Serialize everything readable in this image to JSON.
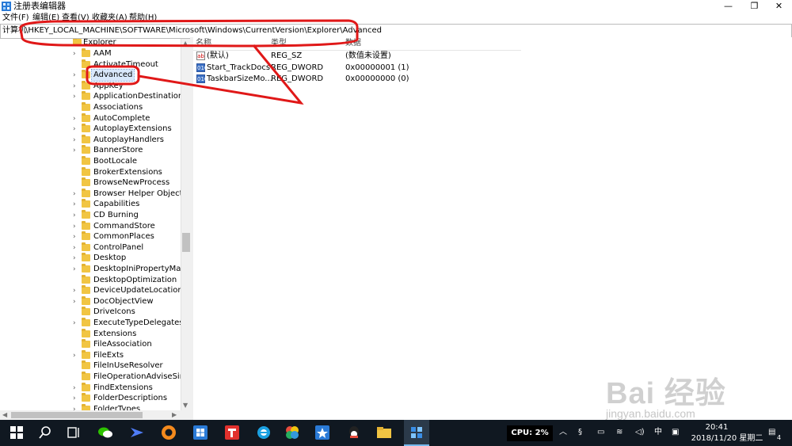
{
  "window": {
    "title": "注册表编辑器",
    "minimize_glyph": "—",
    "maximize_glyph": "❐",
    "close_glyph": "✕"
  },
  "menu": [
    "文件(F)",
    "编辑(E)",
    "查看(V)",
    "收藏夹(A)",
    "帮助(H)"
  ],
  "address": {
    "label": "计算机",
    "path": "\\HKEY_LOCAL_MACHINE\\SOFTWARE\\Microsoft\\Windows\\CurrentVersion\\Explorer\\Advanced"
  },
  "tree": {
    "parent": "Explorer",
    "items": [
      {
        "label": "AAM",
        "expandable": true
      },
      {
        "label": "ActivateTimeout",
        "expandable": false
      },
      {
        "label": "Advanced",
        "expandable": true,
        "selected": true
      },
      {
        "label": "AppKey",
        "expandable": true
      },
      {
        "label": "ApplicationDestinations",
        "expandable": true
      },
      {
        "label": "Associations",
        "expandable": false
      },
      {
        "label": "AutoComplete",
        "expandable": true
      },
      {
        "label": "AutoplayExtensions",
        "expandable": true
      },
      {
        "label": "AutoplayHandlers",
        "expandable": true
      },
      {
        "label": "BannerStore",
        "expandable": true
      },
      {
        "label": "BootLocale",
        "expandable": false
      },
      {
        "label": "BrokerExtensions",
        "expandable": false
      },
      {
        "label": "BrowseNewProcess",
        "expandable": false
      },
      {
        "label": "Browser Helper Objects",
        "expandable": true
      },
      {
        "label": "Capabilities",
        "expandable": true
      },
      {
        "label": "CD Burning",
        "expandable": true
      },
      {
        "label": "CommandStore",
        "expandable": true
      },
      {
        "label": "CommonPlaces",
        "expandable": true
      },
      {
        "label": "ControlPanel",
        "expandable": true
      },
      {
        "label": "Desktop",
        "expandable": true
      },
      {
        "label": "DesktopIniPropertyMap",
        "expandable": true
      },
      {
        "label": "DesktopOptimization",
        "expandable": false
      },
      {
        "label": "DeviceUpdateLocations",
        "expandable": true
      },
      {
        "label": "DocObjectView",
        "expandable": true
      },
      {
        "label": "DriveIcons",
        "expandable": false
      },
      {
        "label": "ExecuteTypeDelegates",
        "expandable": true
      },
      {
        "label": "Extensions",
        "expandable": false
      },
      {
        "label": "FileAssociation",
        "expandable": false
      },
      {
        "label": "FileExts",
        "expandable": true
      },
      {
        "label": "FileInUseResolver",
        "expandable": false
      },
      {
        "label": "FileOperationAdviseSink",
        "expandable": false
      },
      {
        "label": "FindExtensions",
        "expandable": true
      },
      {
        "label": "FolderDescriptions",
        "expandable": true
      },
      {
        "label": "FolderTypes",
        "expandable": true
      }
    ]
  },
  "values": {
    "columns": {
      "name": "名称",
      "type": "类型",
      "data": "数据"
    },
    "rows": [
      {
        "icon": "string-value-icon",
        "icon_text": "ab",
        "name": "(默认)",
        "type": "REG_SZ",
        "data": "(数值未设置)"
      },
      {
        "icon": "dword-value-icon",
        "icon_text": "010",
        "name": "Start_TrackDocs",
        "type": "REG_DWORD",
        "data": "0x00000001 (1)"
      },
      {
        "icon": "dword-value-icon",
        "icon_text": "010",
        "name": "TaskbarSizeMo...",
        "type": "REG_DWORD",
        "data": "0x00000000 (0)"
      }
    ]
  },
  "watermark": {
    "brand": "Bai 经验",
    "url": "jingyan.baidu.com"
  },
  "taskbar": {
    "cpu": "CPU: 2%",
    "ime": "中",
    "time": "20:41",
    "date": "2018/11/20 星期二",
    "notifications": "4",
    "apps": [
      "start-icon",
      "search-icon",
      "task-view-icon",
      "wechat-icon",
      "feishu-icon",
      "chrome-icon",
      "table-app-icon",
      "xmind-icon",
      "ie-icon",
      "color-app-icon",
      "game-icon",
      "qq-icon",
      "file-explorer-icon",
      "regedit-icon"
    ]
  },
  "colors": {
    "annotation": "#e01818",
    "taskbar": "#101821",
    "selection": "#d9e8fb",
    "folder": "#f1c543"
  }
}
